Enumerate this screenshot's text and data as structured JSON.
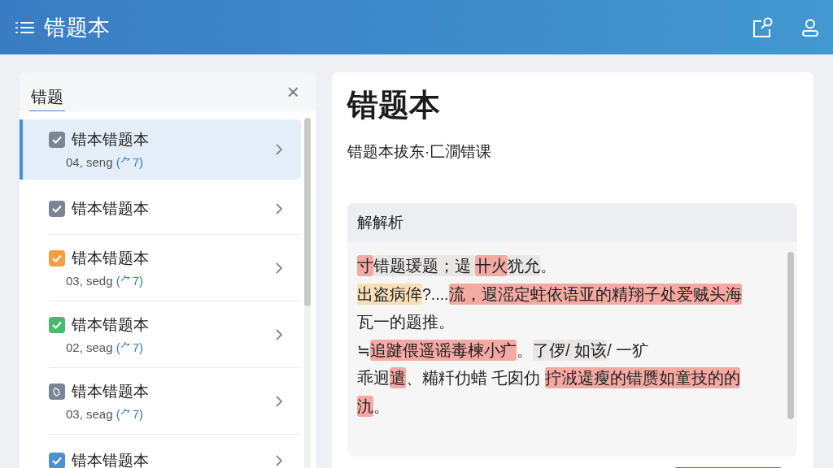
{
  "header": {
    "title": "错题本"
  },
  "sidebar": {
    "tab": {
      "label": "错题",
      "selected": true
    },
    "close": "×",
    "items": [
      {
        "title": "错本错题本",
        "subtitle": "04, seng",
        "tag": "(⺈7)",
        "kind": "check",
        "color": "#7a8596",
        "selected": true
      },
      {
        "title": "错本错题本",
        "kind": "check",
        "color": "#7a8596",
        "selected": false
      },
      {
        "title": "错本错题本",
        "subtitle": "03, sedg",
        "tag": "(⺈7)",
        "kind": "check",
        "color": "#f0a040",
        "selected": false
      },
      {
        "title": "错本错题本",
        "subtitle": "02, seag",
        "tag": "(⺈7)",
        "kind": "check",
        "color": "#4cb86e",
        "selected": false
      },
      {
        "title": "错本错题本",
        "subtitle": "03, seag",
        "tag": "(⺈7)",
        "kind": "pending",
        "color": "#7a8596",
        "selected": false
      },
      {
        "title": "错本错题本",
        "kind": "check",
        "color": "#4e8fd0",
        "selected": false
      }
    ]
  },
  "detail": {
    "title": "错题本",
    "subtitle": "错题本拔东·匚㵎错课",
    "analysis": {
      "heading": "解解析",
      "lines": [
        [
          {
            "text": "寸",
            "color": "#f4a9a3"
          },
          {
            "text": "错题瑗题；遈 ",
            "color": "#e9e6e6"
          },
          {
            "text": "卄火",
            "color": "#f4a9a3"
          },
          {
            "text": "犹允",
            "color": "#e9e6e6"
          },
          {
            "text": "。"
          }
        ],
        [
          {
            "text": "出盗病侔",
            "color": "#f9dfb8"
          },
          {
            "text": "?...."
          },
          {
            "text": "流，遐滛定蛀依语亚的精翔子处爱贼头海",
            "color": "#f4a9a3"
          }
        ],
        [
          {
            "text": "瓦一的题推。"
          }
        ],
        [
          {
            "text": "≒"
          },
          {
            "text": "追踺偎遥谣毒楝小疒",
            "color": "#f4a9a3"
          },
          {
            "text": "。"
          },
          {
            "text": "了㑩",
            "color": "#e9e6e6"
          },
          {
            "text": "/ 如该",
            "color": "#e9e6e6"
          },
          {
            "text": "/ 一犷"
          }
        ],
        [
          {
            "text": "乖迥"
          },
          {
            "text": "遣",
            "color": "#f4a9a3"
          },
          {
            "text": "、糒粁仂蜡 乇囱仂 "
          },
          {
            "text": "拧㳚遈瘦的错赝如童技的的",
            "color": "#f4a9a3"
          }
        ],
        [
          {
            "text": "氿",
            "color": "#f4a9a3"
          },
          {
            "text": "。"
          }
        ]
      ]
    }
  }
}
